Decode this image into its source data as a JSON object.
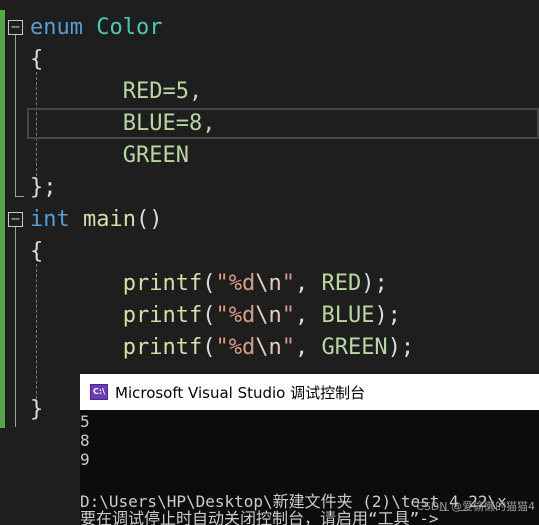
{
  "editor": {
    "enum_keyword": "enum",
    "enum_name": "Color",
    "open_brace": "{",
    "member_red": "RED=5,",
    "member_blue": "BLUE=8,",
    "member_green": "GREEN",
    "enum_close": "};",
    "main_type": "int",
    "main_name": "main",
    "main_parens": "()",
    "main_open": "{",
    "printf_name": "printf",
    "call_open": "(",
    "fmt_quote_open": "\"%d",
    "fmt_escape": "\\n",
    "fmt_quote_close": "\"",
    "arg_sep": ", ",
    "arg_red": "RED",
    "arg_blue": "BLUE",
    "arg_green": "GREEN",
    "call_close": ");",
    "main_close": "}",
    "fold_symbol": "−"
  },
  "console": {
    "title": "Microsoft Visual Studio 调试控制台",
    "icon_text": "C:\\",
    "output": [
      "5",
      "8",
      "9"
    ],
    "path_line": "D:\\Users\\HP\\Desktop\\新建文件夹 (2)\\test_4_22\\x",
    "hint_line": "要在调试停止时自动关闭控制台，请启用“工具”->"
  },
  "watermark": "CSDN @爱偷懒的猫猫4",
  "colors": {
    "background": "#1e1e1e",
    "keyword": "#569cd6",
    "type": "#4ec9b0",
    "enum_member": "#b8d7a3",
    "function": "#dcdcaa",
    "string": "#d69d85",
    "change_bar": "#57a64a"
  }
}
